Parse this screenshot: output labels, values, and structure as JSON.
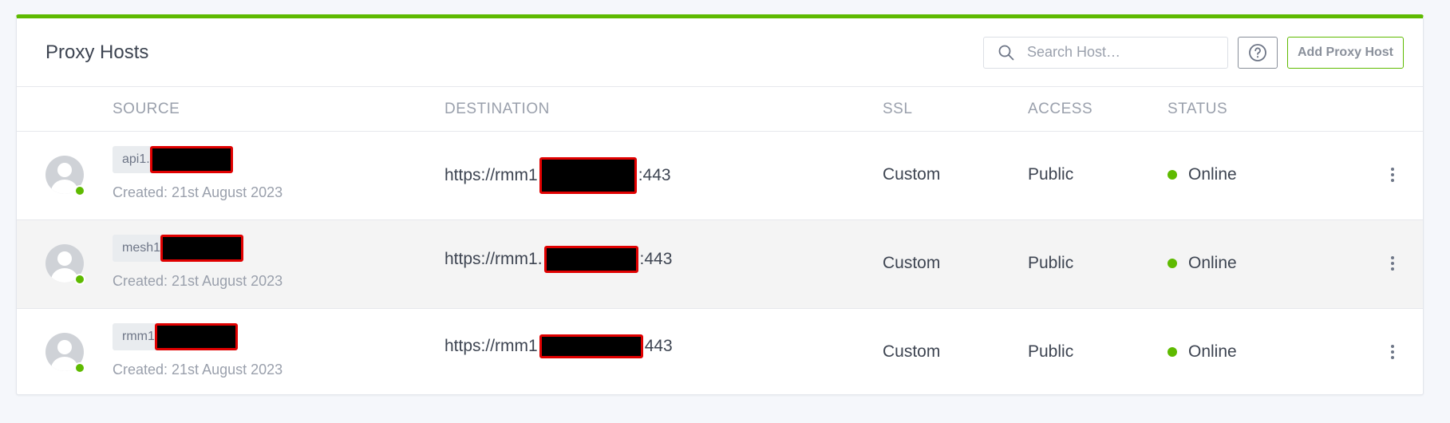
{
  "header": {
    "title": "Proxy Hosts",
    "search_placeholder": "Search Host…",
    "add_button_label": "Add Proxy Host"
  },
  "columns": [
    "SOURCE",
    "DESTINATION",
    "SSL",
    "ACCESS",
    "STATUS"
  ],
  "rows": [
    {
      "source": "api1.",
      "created": "Created: 21st August 2023",
      "destination_prefix": "https://rmm1",
      "destination_suffix": ":443",
      "ssl": "Custom",
      "access": "Public",
      "status": "Online"
    },
    {
      "source": "mesh1",
      "created": "Created: 21st August 2023",
      "destination_prefix": "https://rmm1.",
      "destination_suffix": ":443",
      "ssl": "Custom",
      "access": "Public",
      "status": "Online"
    },
    {
      "source": "rmm1",
      "created": "Created: 21st August 2023",
      "destination_prefix": "https://rmm1",
      "destination_suffix": "443",
      "ssl": "Custom",
      "access": "Public",
      "status": "Online"
    }
  ],
  "colors": {
    "accent": "#5eba00",
    "online": "#5eba00",
    "redaction_fill": "#000000",
    "redaction_border": "#e00000"
  },
  "icons": [
    "search-icon",
    "help-icon",
    "user-avatar-icon",
    "more-vertical-icon"
  ]
}
